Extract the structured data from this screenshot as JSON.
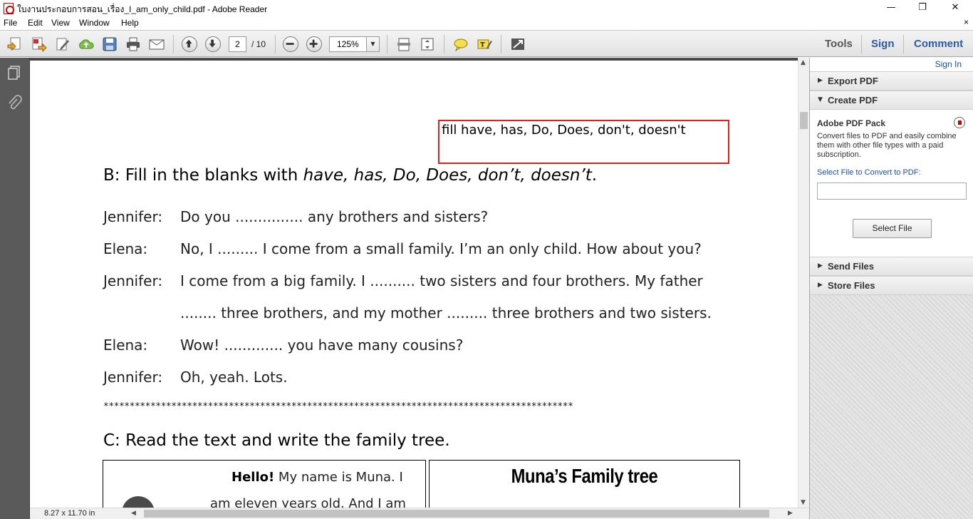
{
  "window": {
    "title": "ใบงานประกอบการสอน_เรื่อง_I_am_only_child.pdf - Adobe Reader",
    "minimize": "—",
    "maximize": "❐",
    "close": "✕"
  },
  "menu": {
    "items": [
      "File",
      "Edit",
      "View",
      "Window",
      "Help"
    ],
    "close_doc": "×"
  },
  "toolbar": {
    "current_page": "2",
    "total_pages": "/ 10",
    "zoom": "125%",
    "tools_label": "Tools",
    "sign_label": "Sign",
    "comment_label": "Comment"
  },
  "document": {
    "annotation": "fill have, has, Do, Does, don't, doesn't",
    "section_b_prefix": "B:  Fill in the blanks with ",
    "section_b_words": "have, has, Do, Does, don’t, doesn’t",
    "section_b_end": ".",
    "dialogue": [
      {
        "speaker": "Jennifer:",
        "text": "Do you ............... any brothers and sisters?"
      },
      {
        "speaker": "Elena:",
        "text": "No, I ......... I come from a small family. I’m an only child. How about you?"
      },
      {
        "speaker": "Jennifer:",
        "text": "I come from a big family. I .......... two sisters and four brothers. My father"
      },
      {
        "speaker": "",
        "text": "........ three brothers, and my mother ......... three brothers and two sisters."
      },
      {
        "speaker": "Elena:",
        "text": "Wow! ............. you have many cousins?"
      },
      {
        "speaker": "Jennifer:",
        "text": "Oh, yeah. Lots."
      }
    ],
    "stars": "******************************************************************************************",
    "section_c": "C: Read the text and write the family tree.",
    "muna_hello": "Hello!",
    "muna_line1": "  My name is Muna. I",
    "muna_line2": "am eleven years old. And I am",
    "tree_title": "Muna’s Family tree"
  },
  "status": {
    "page_size": "8.27 x 11.70 in"
  },
  "right_pane": {
    "sign_in": "Sign In",
    "export_pdf": "Export PDF",
    "create_pdf": "Create PDF",
    "pack_title": "Adobe PDF Pack",
    "pack_desc": "Convert files to PDF and easily combine them with other file types with a paid subscription.",
    "select_label": "Select File to Convert to PDF:",
    "select_button": "Select File",
    "send_files": "Send Files",
    "store_files": "Store Files"
  },
  "colors": {
    "accent_blue": "#1a4fb0",
    "toolbar_link": "#2b5aa6",
    "annotation_red": "#e02020",
    "nav_dark": "#5a5a5a"
  },
  "icons": [
    "create-pdf-icon",
    "export-pdf-icon",
    "edit-icon",
    "cloud-upload-icon",
    "save-icon",
    "print-icon",
    "email-icon",
    "page-up-icon",
    "page-down-icon",
    "zoom-out-icon",
    "zoom-in-icon",
    "fit-page-icon",
    "fit-width-icon",
    "comment-icon",
    "highlight-icon",
    "fullscreen-icon",
    "pages-icon",
    "attachment-icon"
  ]
}
